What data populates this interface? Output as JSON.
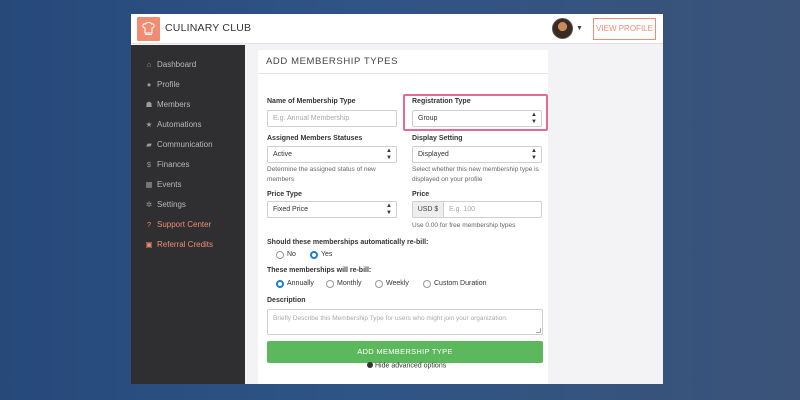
{
  "brand": {
    "name": "CULINARY CLUB",
    "logo_color": "#ef8c74"
  },
  "header": {
    "view_profile_label": "VIEW PROFILE"
  },
  "sidebar": {
    "items": [
      {
        "label": "Dashboard",
        "icon": "home-icon"
      },
      {
        "label": "Profile",
        "icon": "globe-icon"
      },
      {
        "label": "Members",
        "icon": "users-icon"
      },
      {
        "label": "Automations",
        "icon": "star-icon"
      },
      {
        "label": "Communication",
        "icon": "chat-icon"
      },
      {
        "label": "Finances",
        "icon": "dollar-icon"
      },
      {
        "label": "Events",
        "icon": "calendar-icon"
      },
      {
        "label": "Settings",
        "icon": "gear-icon"
      },
      {
        "label": "Support Center",
        "icon": "question-icon"
      },
      {
        "label": "Referral Credits",
        "icon": "gift-icon"
      }
    ]
  },
  "form": {
    "title": "ADD MEMBERSHIP TYPES",
    "name_label": "Name of Membership Type",
    "name_placeholder": "E.g. Annual Membership",
    "registration_label": "Registration Type",
    "registration_value": "Group",
    "statuses_label": "Assigned Members Statuses",
    "statuses_value": "Active",
    "statuses_help": "Determine the assigned status of new members",
    "display_label": "Display Setting",
    "display_value": "Displayed",
    "display_help": "Select whether this new membership type is displayed on your profile",
    "price_type_label": "Price Type",
    "price_type_value": "Fixed Price",
    "price_label": "Price",
    "price_prefix": "USD $",
    "price_placeholder": "E.g. 100",
    "price_help": "Use 0.00 for free membership types",
    "rebill_label": "Should these memberships automatically re-bill:",
    "rebill_options": [
      "No",
      "Yes"
    ],
    "rebill_selected": "Yes",
    "frequency_label": "These memberships will re-bill:",
    "frequency_options": [
      "Annually",
      "Monthly",
      "Weekly",
      "Custom Duration"
    ],
    "frequency_selected": "Annually",
    "description_label": "Description",
    "description_placeholder": "Briefly Describe this Membership Type for users who might join your organization.",
    "submit_label": "ADD MEMBERSHIP TYPE",
    "advanced_label": "Hide advanced options"
  },
  "colors": {
    "accent": "#ef8c74",
    "highlight": "#e66a94",
    "submit": "#5cb85c",
    "radio": "#1f7ed0",
    "sidebar": "#2f2f31"
  }
}
